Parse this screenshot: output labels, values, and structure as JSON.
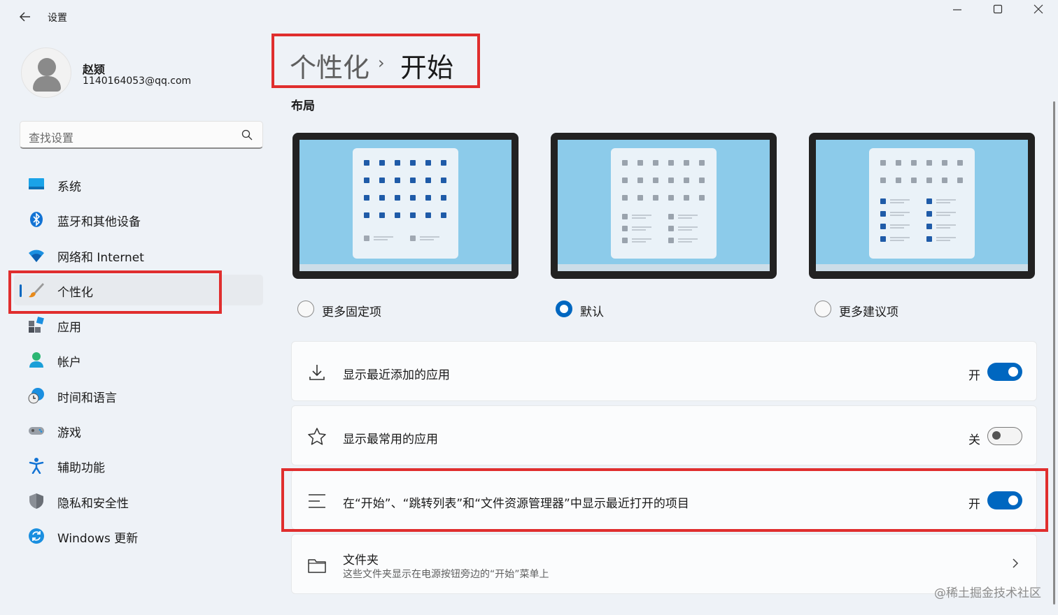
{
  "window": {
    "title": "设置",
    "back_icon": "arrow-left-icon",
    "controls": [
      "minimize-icon",
      "maximize-icon",
      "close-icon"
    ]
  },
  "user": {
    "name": "赵颎",
    "email": "1140164053@qq.com"
  },
  "search": {
    "placeholder": "查找设置",
    "icon": "search-icon"
  },
  "sidebar": {
    "items": [
      {
        "label": "系统",
        "icon": "monitor-icon"
      },
      {
        "label": "蓝牙和其他设备",
        "icon": "bluetooth-icon"
      },
      {
        "label": "网络和 Internet",
        "icon": "wifi-icon"
      },
      {
        "label": "个性化",
        "icon": "paintbrush-icon",
        "active": true
      },
      {
        "label": "应用",
        "icon": "apps-icon"
      },
      {
        "label": "帐户",
        "icon": "person-icon"
      },
      {
        "label": "时间和语言",
        "icon": "globe-clock-icon"
      },
      {
        "label": "游戏",
        "icon": "gamepad-icon"
      },
      {
        "label": "辅助功能",
        "icon": "accessibility-icon"
      },
      {
        "label": "隐私和安全性",
        "icon": "shield-icon"
      },
      {
        "label": "Windows 更新",
        "icon": "refresh-icon"
      }
    ]
  },
  "breadcrumb": {
    "parent": "个性化",
    "separator": "›",
    "current": "开始"
  },
  "layout": {
    "label": "布局",
    "options": [
      {
        "label": "更多固定项",
        "selected": false
      },
      {
        "label": "默认",
        "selected": true
      },
      {
        "label": "更多建议项",
        "selected": false
      }
    ]
  },
  "settings": [
    {
      "label": "显示最近添加的应用",
      "state": "开",
      "on": true,
      "icon": "download-icon"
    },
    {
      "label": "显示最常用的应用",
      "state": "关",
      "on": false,
      "icon": "star-icon"
    },
    {
      "label": "在“开始”、“跳转列表”和“文件资源管理器”中显示最近打开的项目",
      "state": "开",
      "on": true,
      "icon": "list-icon"
    }
  ],
  "folders": {
    "label": "文件夹",
    "description": "这些文件夹显示在电源按钮旁边的“开始”菜单上",
    "icon": "folder-icon",
    "chevron": "chevron-right-icon"
  },
  "watermark": "@稀土掘金技术社区",
  "colors": {
    "accent": "#0067c0",
    "highlight": "#e02e2e",
    "background": "#eef2f7"
  }
}
